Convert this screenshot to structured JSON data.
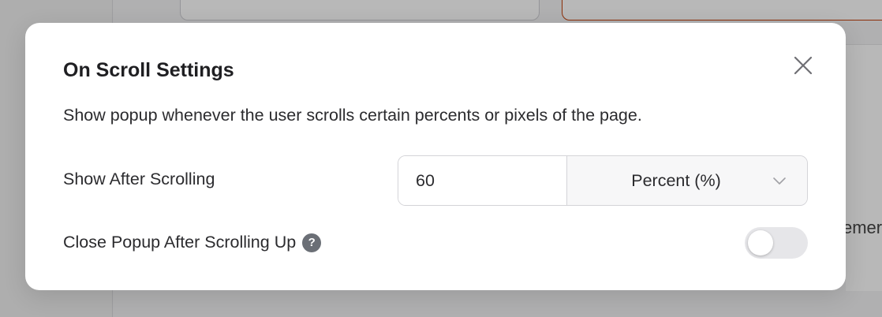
{
  "background": {
    "partial_text": "emer"
  },
  "modal": {
    "title": "On Scroll Settings",
    "close_icon": "close-icon",
    "description": "Show popup whenever the user scrolls certain percents or pixels of the page.",
    "show_after_scrolling": {
      "label": "Show After Scrolling",
      "value": "60",
      "unit": "Percent (%)",
      "unit_icon": "chevron-down-icon"
    },
    "close_after_scrolling_up": {
      "label": "Close Popup After Scrolling Up",
      "help_icon": "help-icon",
      "help_glyph": "?",
      "enabled": false
    }
  },
  "colors": {
    "accent_border": "#c2410c",
    "help_icon_bg": "#6b6f76",
    "toggle_off": "#e6e6e9"
  }
}
